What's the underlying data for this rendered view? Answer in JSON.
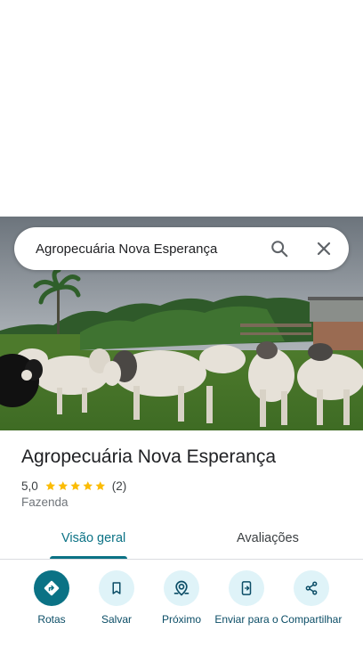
{
  "search": {
    "query": "Agropecuária Nova Esperança"
  },
  "place": {
    "name": "Agropecuária Nova Esperança",
    "rating": "5,0",
    "stars": 5,
    "review_count": "(2)",
    "category": "Fazenda"
  },
  "tabs": [
    {
      "label": "Visão geral",
      "active": true
    },
    {
      "label": "Avaliações",
      "active": false
    }
  ],
  "actions": [
    {
      "label": "Rotas",
      "icon": "directions-icon"
    },
    {
      "label": "Salvar",
      "icon": "bookmark-icon"
    },
    {
      "label": "Próximo",
      "icon": "nearby-icon"
    },
    {
      "label": "Enviar para o",
      "icon": "send-to-phone-icon"
    },
    {
      "label": "Compartilhar",
      "icon": "share-icon"
    }
  ],
  "colors": {
    "accent": "#0b7285",
    "star": "#fbbc04",
    "action_bg": "#dff3f8"
  }
}
